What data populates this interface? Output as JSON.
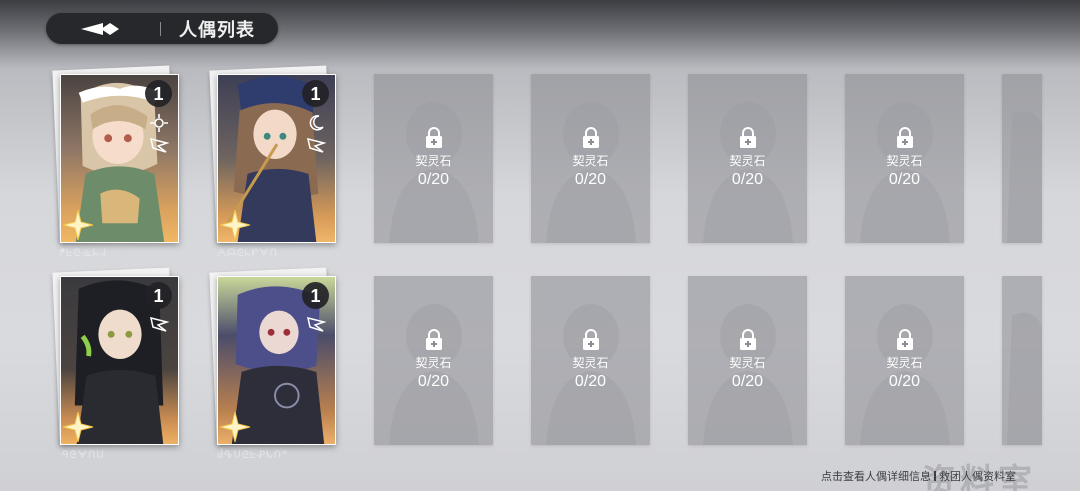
{
  "header": {
    "title": "人偶列表"
  },
  "owned_cards": [
    {
      "level": "1",
      "name": "ᖰᖶᘓᓍᖾᖽ",
      "classes": [
        "sun-class-icon",
        "wing-class-icon"
      ],
      "theme": "#c98d53"
    },
    {
      "level": "1",
      "name": "ᗅᗩᘓᖾᗁᗄᑎ",
      "classes": [
        "moon-class-icon",
        "wing-class-icon"
      ],
      "theme": "#b07a4e"
    },
    {
      "level": "1",
      "name": "ᑴᘓᗄᑎᑌ",
      "classes": [
        "wing-class-icon"
      ],
      "theme": "#9a6a40"
    },
    {
      "level": "1",
      "name": "ᑰᕴᑌᘓᖶᕵᗃᑎᐜ",
      "classes": [
        "wing-class-icon"
      ],
      "theme": "#a9714a"
    }
  ],
  "locked_cards": {
    "stone_label": "契灵石",
    "rows": [
      [
        "0/20",
        "0/20",
        "0/20",
        "0/20"
      ],
      [
        "0/20",
        "0/20",
        "0/20",
        "0/20"
      ]
    ]
  },
  "footer": {
    "hint": "点击查看人偶详细信息",
    "link": "救团人偶资料室"
  },
  "watermark": "资料室",
  "colors": {
    "header_bg": "#27282c",
    "locked_card": "#8c8d92",
    "star": "#f4c64a"
  }
}
